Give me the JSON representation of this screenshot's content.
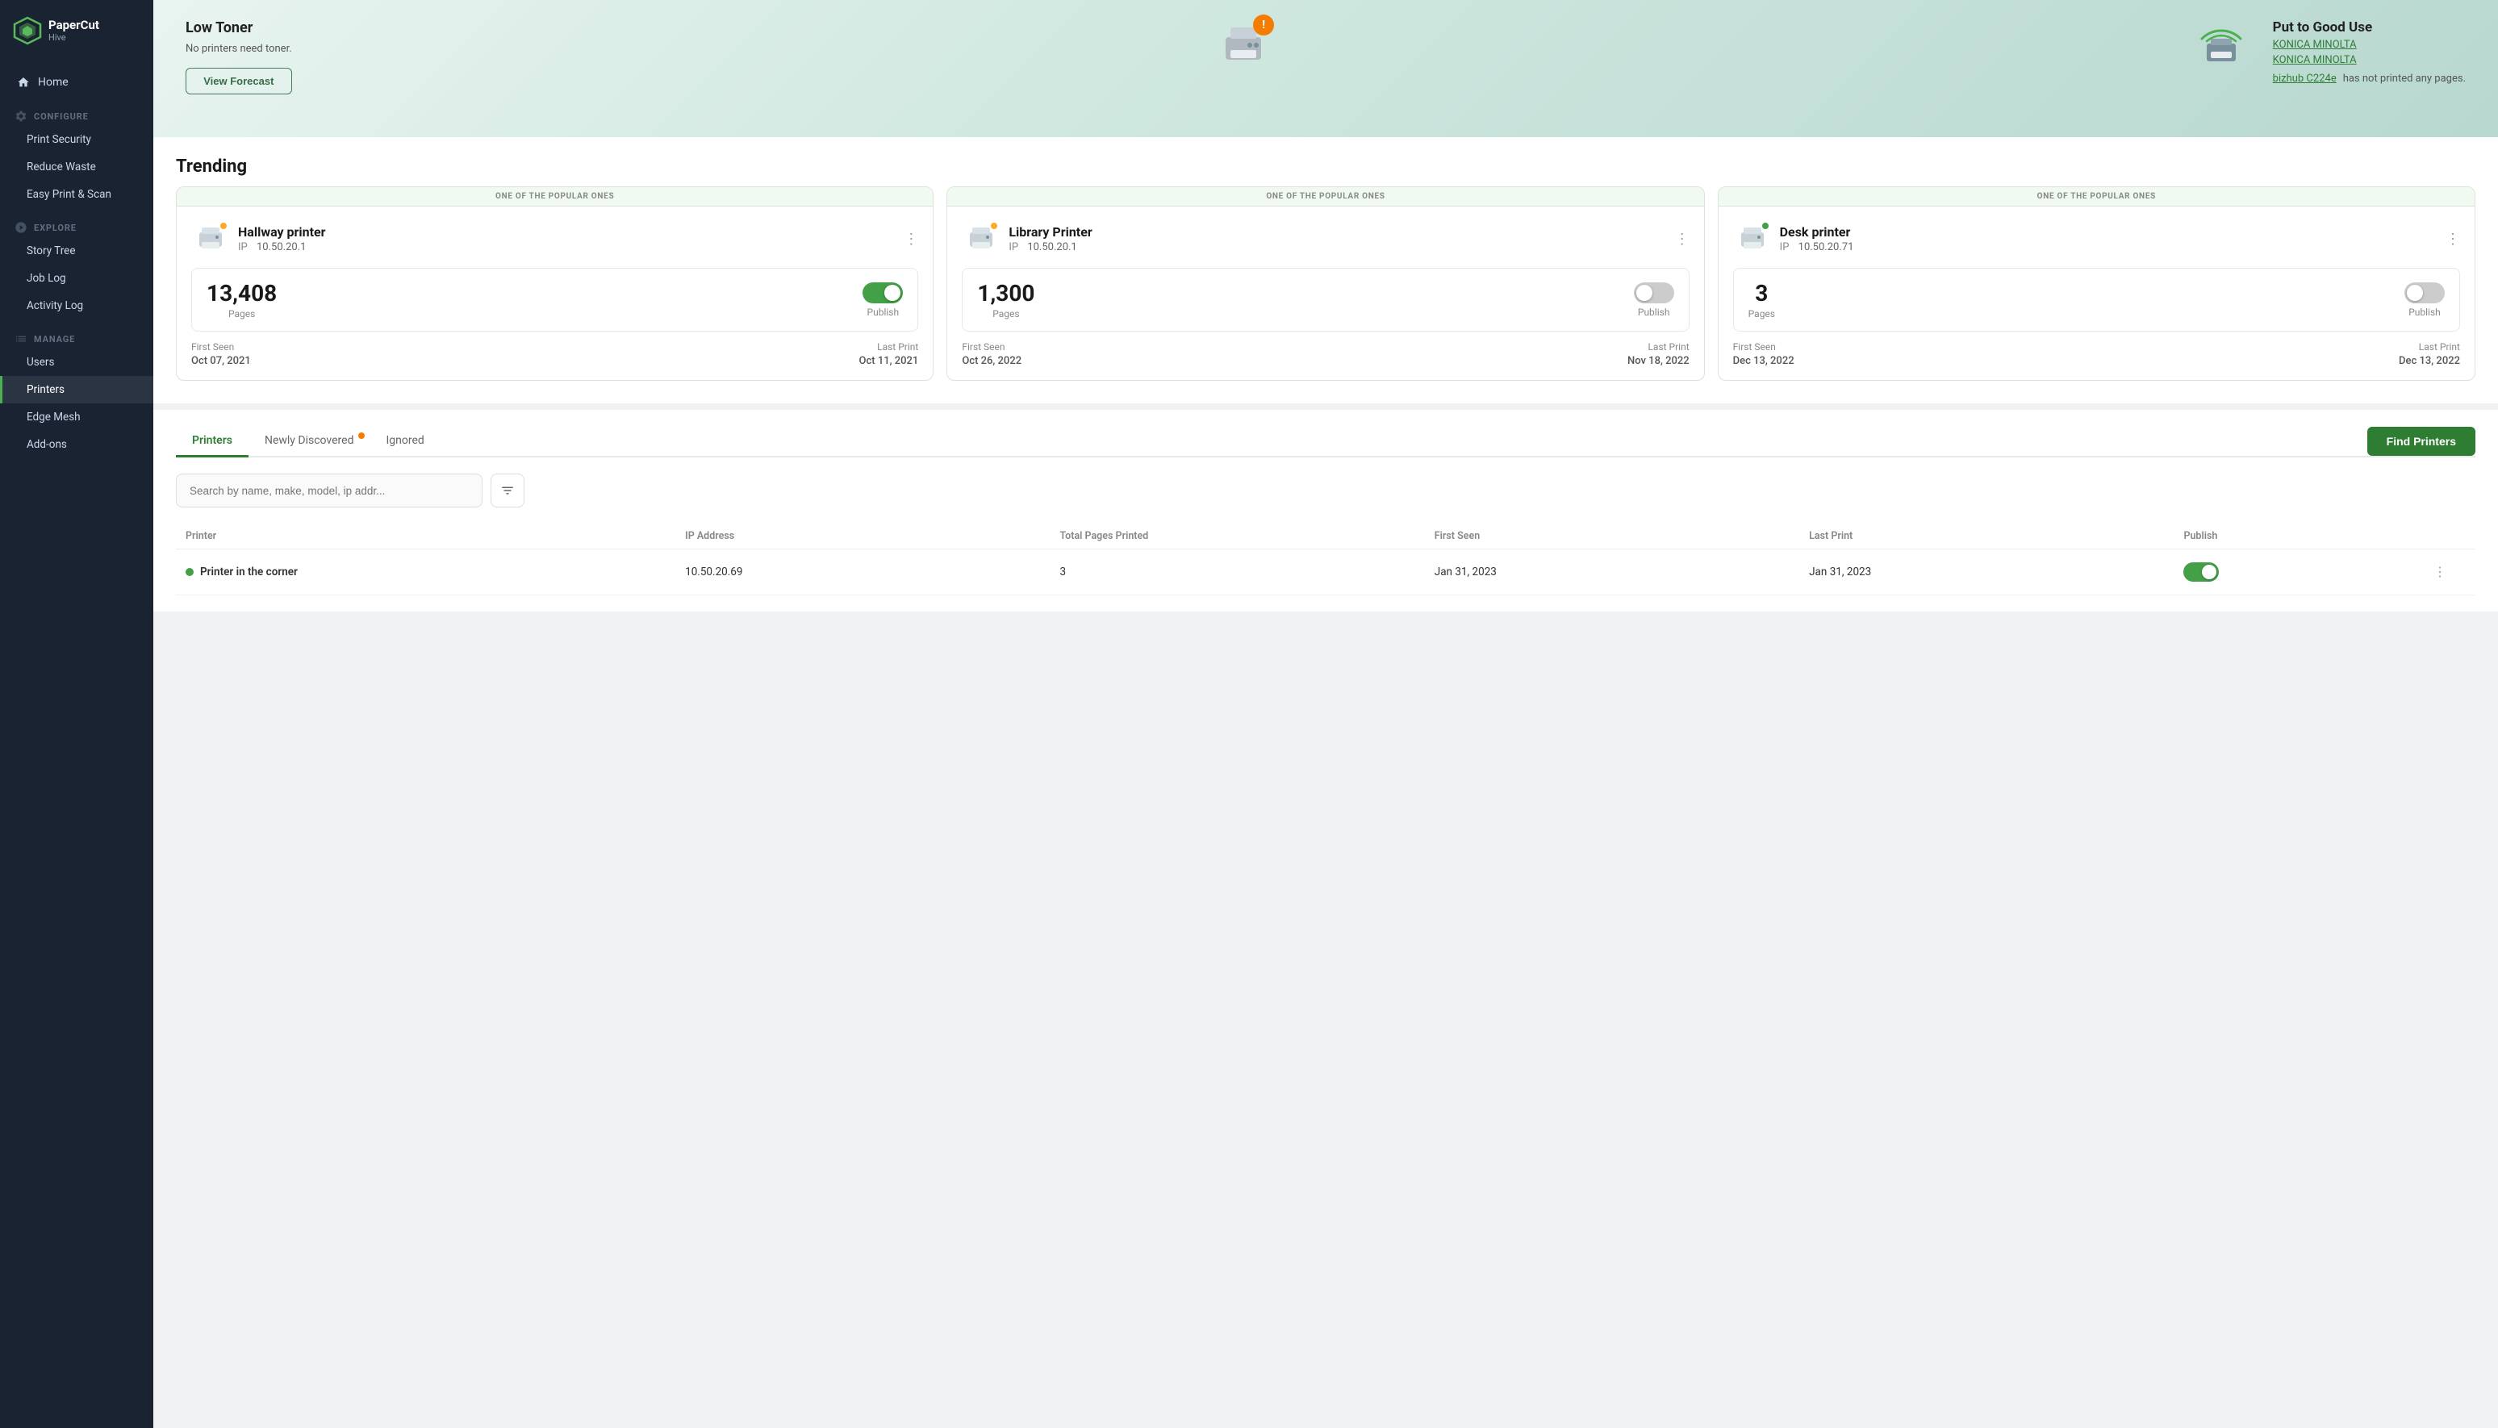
{
  "sidebar": {
    "logo": {
      "name": "PaperCut",
      "sub": "Hive"
    },
    "nav": [
      {
        "id": "home",
        "label": "Home",
        "icon": "home",
        "type": "item"
      },
      {
        "id": "configure",
        "label": "CONFIGURE",
        "type": "section"
      },
      {
        "id": "print-security",
        "label": "Print Security",
        "type": "sub"
      },
      {
        "id": "reduce-waste",
        "label": "Reduce Waste",
        "type": "sub"
      },
      {
        "id": "easy-print-scan",
        "label": "Easy Print & Scan",
        "type": "sub"
      },
      {
        "id": "explore",
        "label": "EXPLORE",
        "type": "section"
      },
      {
        "id": "story-tree",
        "label": "Story Tree",
        "type": "sub"
      },
      {
        "id": "job-log",
        "label": "Job Log",
        "type": "sub"
      },
      {
        "id": "activity-log",
        "label": "Activity Log",
        "type": "sub"
      },
      {
        "id": "manage",
        "label": "MANAGE",
        "type": "section"
      },
      {
        "id": "users",
        "label": "Users",
        "type": "sub"
      },
      {
        "id": "printers",
        "label": "Printers",
        "type": "sub",
        "active": true
      },
      {
        "id": "edge-mesh",
        "label": "Edge Mesh",
        "type": "sub"
      },
      {
        "id": "add-ons",
        "label": "Add-ons",
        "type": "sub"
      }
    ]
  },
  "hero": {
    "left": {
      "title": "Low Toner",
      "subtitle": "No printers need toner.",
      "button_label": "View Forecast"
    },
    "right": {
      "title": "Put to Good Use",
      "link1": "KONICA MINOLTA",
      "link2": "KONICA MINOLTA",
      "link3": "bizhub C224e",
      "text": "has not printed any pages."
    }
  },
  "trending": {
    "section_title": "Trending",
    "badge_label": "ONE OF THE POPULAR ONES",
    "cards": [
      {
        "name": "Hallway printer",
        "ip": "10.50.20.1",
        "pages": "13,408",
        "pages_label": "Pages",
        "publish_label": "Publish",
        "publish_on": true,
        "status": "yellow",
        "first_seen_label": "First Seen",
        "first_seen_date": "Oct 07, 2021",
        "last_print_label": "Last Print",
        "last_print_date": "Oct 11, 2021"
      },
      {
        "name": "Library Printer",
        "ip": "10.50.20.1",
        "pages": "1,300",
        "pages_label": "Pages",
        "publish_label": "Publish",
        "publish_on": false,
        "status": "yellow",
        "first_seen_label": "First Seen",
        "first_seen_date": "Oct 26, 2022",
        "last_print_label": "Last Print",
        "last_print_date": "Nov 18, 2022"
      },
      {
        "name": "Desk printer",
        "ip": "10.50.20.71",
        "pages": "3",
        "pages_label": "Pages",
        "publish_label": "Publish",
        "publish_on": false,
        "status": "green",
        "first_seen_label": "First Seen",
        "first_seen_date": "Dec 13, 2022",
        "last_print_label": "Last Print",
        "last_print_date": "Dec 13, 2022"
      }
    ]
  },
  "printers_table": {
    "tabs": [
      {
        "id": "printers",
        "label": "Printers",
        "active": true,
        "badge": false
      },
      {
        "id": "newly-discovered",
        "label": "Newly Discovered",
        "active": false,
        "badge": true
      },
      {
        "id": "ignored",
        "label": "Ignored",
        "active": false,
        "badge": false
      }
    ],
    "find_button_label": "Find Printers",
    "search_placeholder": "Search by name, make, model, ip addr...",
    "columns": [
      {
        "id": "printer",
        "label": "Printer"
      },
      {
        "id": "ip-address",
        "label": "IP Address"
      },
      {
        "id": "total-pages",
        "label": "Total Pages Printed"
      },
      {
        "id": "first-seen",
        "label": "First Seen"
      },
      {
        "id": "last-print",
        "label": "Last Print"
      },
      {
        "id": "publish",
        "label": "Publish"
      },
      {
        "id": "actions",
        "label": ""
      }
    ],
    "rows": [
      {
        "name": "Printer in the corner",
        "ip": "10.50.20.69",
        "pages": "3",
        "first_seen": "Jan 31, 2023",
        "last_print": "Jan 31, 2023",
        "publish_on": true,
        "status": "green"
      }
    ]
  }
}
